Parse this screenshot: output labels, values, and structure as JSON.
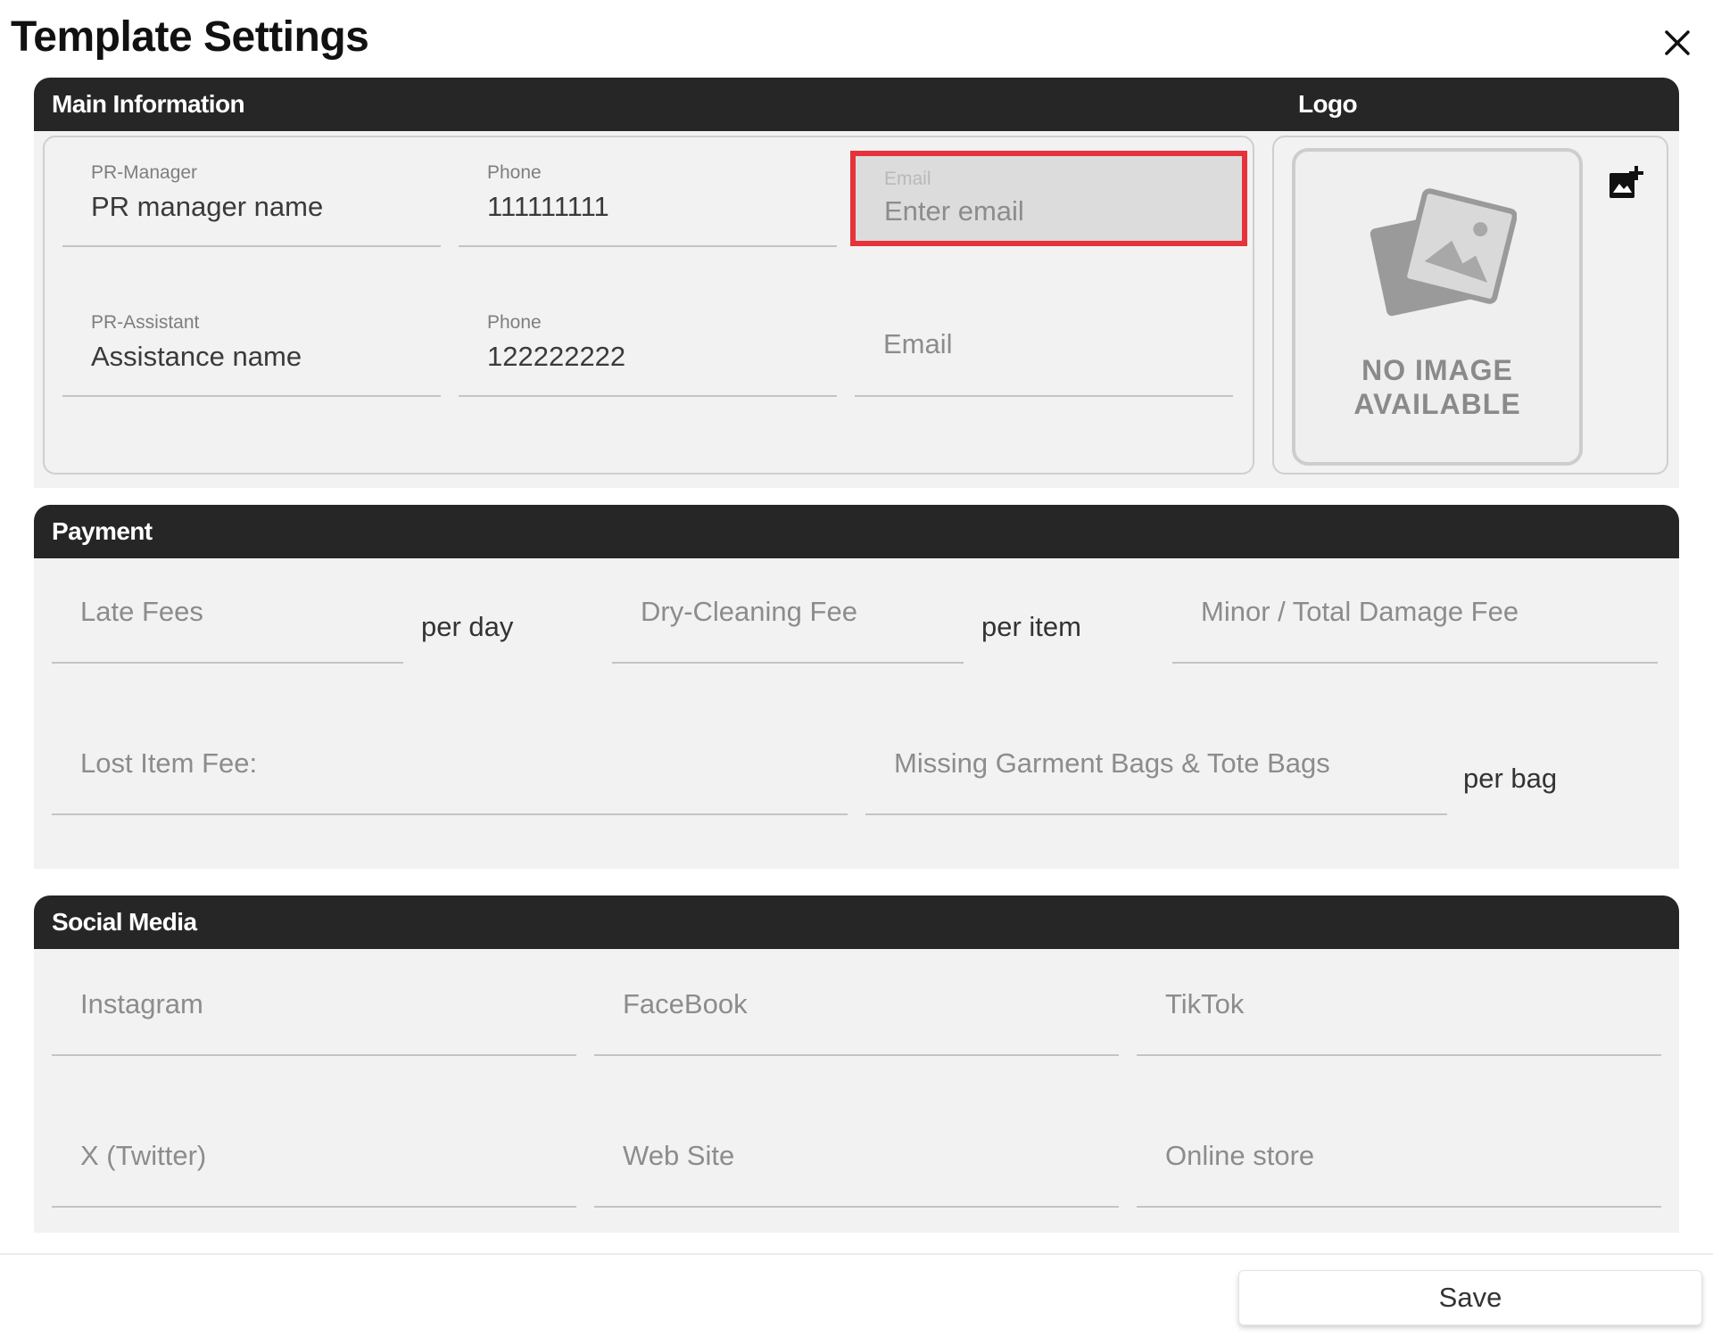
{
  "title": "Template Settings",
  "icons": {
    "close": "close-icon",
    "add_image": "add-photo-icon",
    "placeholder": "image-placeholder-icon"
  },
  "main_info": {
    "header": "Main Information",
    "logo_header": "Logo",
    "pr_manager": {
      "label": "PR-Manager",
      "value": "PR manager name"
    },
    "manager_phone": {
      "label": "Phone",
      "value": "111111111"
    },
    "manager_email": {
      "label": "Email",
      "placeholder": "Enter email"
    },
    "pr_assistant": {
      "label": "PR-Assistant",
      "value": "Assistance name"
    },
    "assistant_phone": {
      "label": "Phone",
      "value": "122222222"
    },
    "assistant_email": {
      "placeholder": "Email"
    },
    "logo_no_image_line1": "NO IMAGE",
    "logo_no_image_line2": "AVAILABLE"
  },
  "payment": {
    "header": "Payment",
    "late_fees": "Late Fees",
    "late_fees_unit": "per day",
    "dry_cleaning": "Dry-Cleaning Fee",
    "dry_cleaning_unit": "per item",
    "damage_fee": "Minor / Total Damage Fee",
    "lost_item": "Lost Item Fee:",
    "missing_bags": "Missing Garment Bags & Tote Bags",
    "missing_bags_unit": "per bag"
  },
  "social": {
    "header": "Social Media",
    "instagram": "Instagram",
    "facebook": "FaceBook",
    "tiktok": "TikTok",
    "twitter": "X (Twitter)",
    "website": "Web Site",
    "online_store": "Online store"
  },
  "save_label": "Save",
  "colors": {
    "header_bar": "#262626",
    "highlight": "#e5323b",
    "panel": "#f2f2f2"
  }
}
